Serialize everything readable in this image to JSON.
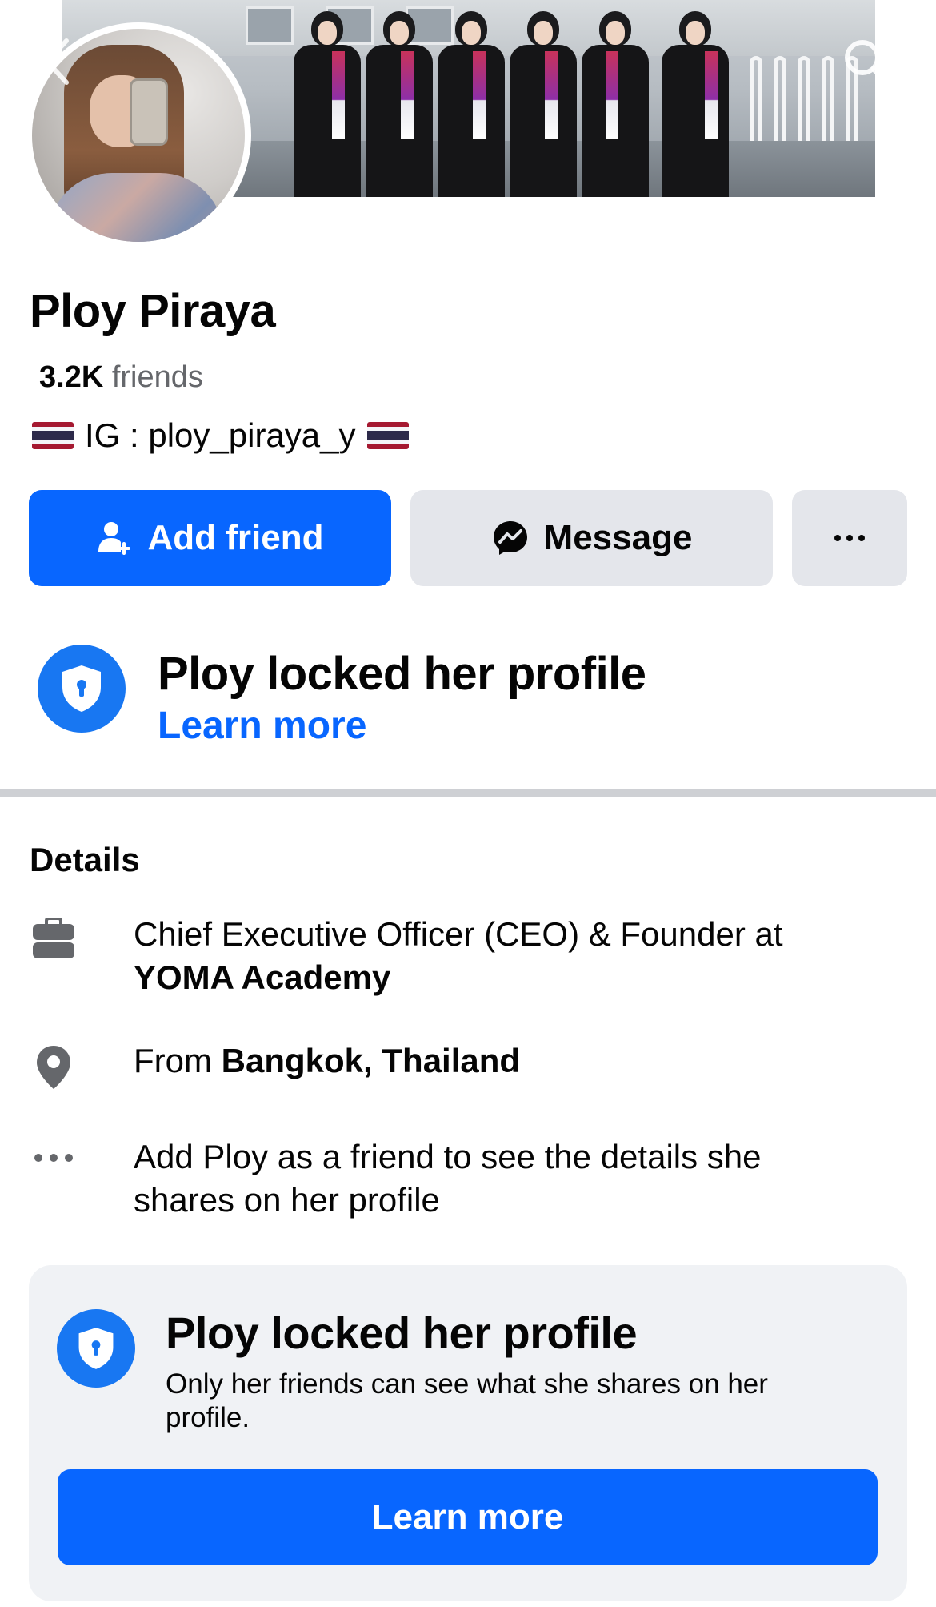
{
  "profile": {
    "name": "Ploy Piraya",
    "friends_count": "3.2K",
    "friends_label": "friends",
    "bio": "IG : ploy_piraya_y"
  },
  "actions": {
    "add_friend": "Add friend",
    "message": "Message",
    "more": "···"
  },
  "lock_notice": {
    "title": "Ploy locked her profile",
    "link": "Learn more"
  },
  "details": {
    "title": "Details",
    "work_prefix": "Chief Executive Officer (CEO) & Founder at",
    "work_org": "YOMA Academy",
    "from_prefix": "From",
    "from_place": "Bangkok, Thailand",
    "more_info": "Add Ploy as a friend to see the details she shares on her profile"
  },
  "locked_card": {
    "title": "Ploy locked her profile",
    "subtitle": "Only her friends can see what she shares on her profile.",
    "button": "Learn more"
  },
  "colors": {
    "primary": "#0866ff",
    "lock_blue": "#1877f2",
    "secondary_bg": "#e4e6eb",
    "card_bg": "#f0f2f5",
    "muted_text": "#65676b"
  },
  "icons": {
    "back": "chevron-left-icon",
    "search": "search-icon",
    "add_friend": "person-add-icon",
    "message": "messenger-icon",
    "lock": "shield-lock-icon",
    "work": "briefcase-icon",
    "location": "location-pin-icon",
    "more": "more-dots-icon"
  }
}
